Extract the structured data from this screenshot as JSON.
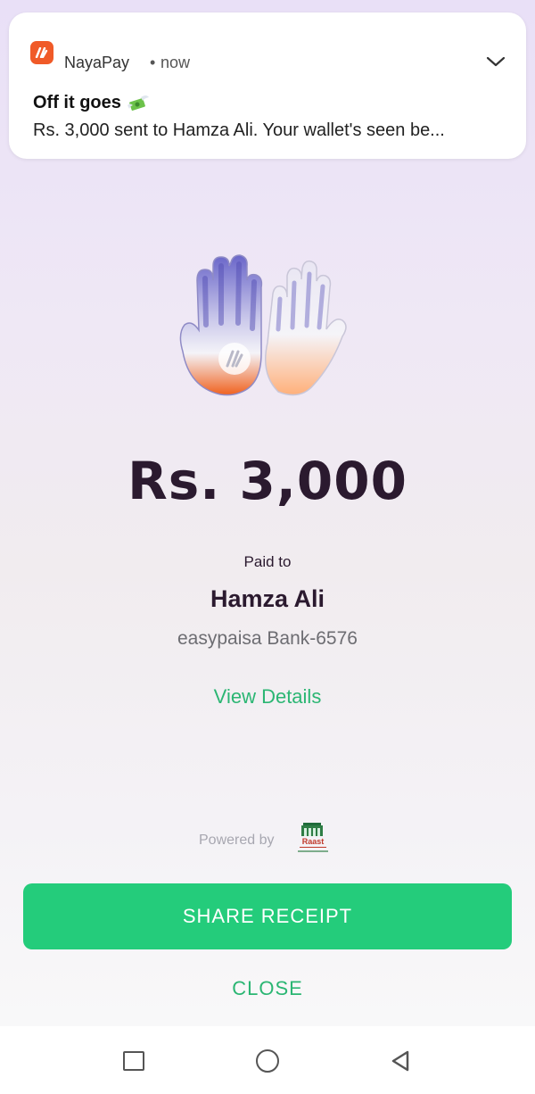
{
  "notification": {
    "app_name": "NayaPay",
    "separator": "•",
    "time": "now",
    "title": "Off it goes",
    "title_emoji": "money-with-wings-icon",
    "body": "Rs. 3,000 sent to Hamza Ali. Your wallet's seen be..."
  },
  "payment": {
    "amount": "Rs. 3,000",
    "paid_to_label": "Paid to",
    "recipient": "Hamza Ali",
    "bank_account": "easypaisa Bank-6576",
    "view_details": "View Details"
  },
  "footer": {
    "powered_by": "Powered by",
    "partner_logo": "Raast"
  },
  "actions": {
    "share": "SHARE RECEIPT",
    "close": "CLOSE"
  },
  "colors": {
    "accent": "#24cc7b",
    "accent_text": "#2bb673",
    "brand": "#f05a28",
    "text_dark": "#2b1a2f"
  }
}
